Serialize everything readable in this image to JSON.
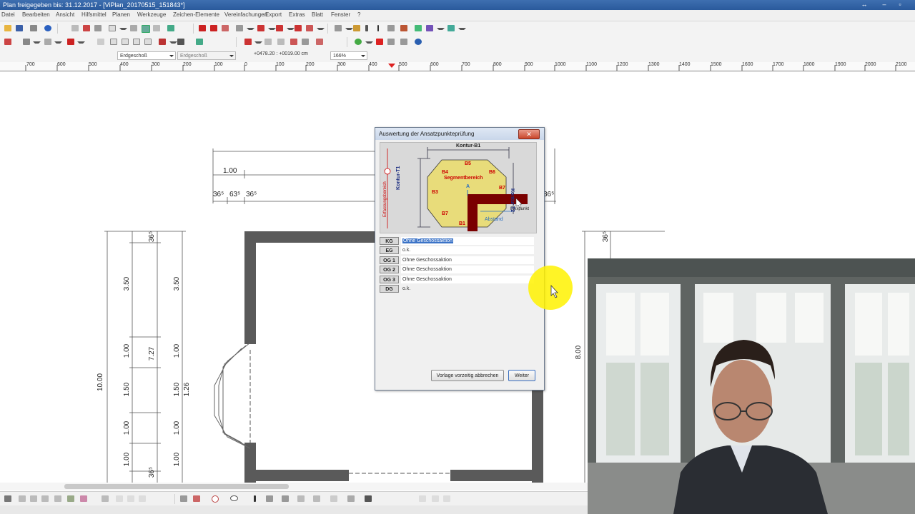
{
  "window": {
    "title": "Plan freigegeben bis: 31.12.2017 - [ViPlan_20170515_151843*]",
    "controls": [
      "↔",
      "–",
      "▫"
    ]
  },
  "menu": [
    "Datei",
    "Bearbeiten",
    "Ansicht",
    "Hilfsmittel",
    "Planen",
    "Werkzeuge",
    "Zeichen-Elemente",
    "Vereinfachungen",
    "Export",
    "Extras",
    "Blatt",
    "Fenster",
    "?"
  ],
  "toolbar2": {
    "floor_combo": "Erdgeschoß",
    "floor_combo2": "Erdgeschoß",
    "coords": "+0478.20 : +0019.00 cm",
    "zoom": "166%"
  },
  "ruler": {
    "labels": [
      "700",
      "600",
      "500",
      "400",
      "300",
      "200",
      "100",
      "0",
      "100",
      "200",
      "300",
      "400",
      "500",
      "600",
      "700",
      "800",
      "900",
      "1000",
      "1100",
      "1200",
      "1300",
      "1400",
      "1500",
      "1600",
      "1700",
      "1800",
      "1900",
      "2000",
      "2100"
    ]
  },
  "drawing": {
    "dim_top": "1.00",
    "dim_row": [
      "36⁵",
      "63⁵",
      "36⁵"
    ],
    "dim_right_small": "36⁵",
    "dim_v_top": "36⁵",
    "dim_v_bottom": "36⁵",
    "dim_v_right": "36⁵",
    "dim_left_total": "10.00",
    "dim_left_col2": [
      "3.50",
      "1.00",
      "1.50",
      "1.00",
      "1.00"
    ],
    "dim_727": "7.27",
    "dim_left_col3": [
      "3.50",
      "1.00",
      "1.50",
      "1.00",
      "1.00"
    ],
    "dim_126": "1.26",
    "dim_right_800": "8.00"
  },
  "dialog": {
    "title": "Auswertung der Ansatzpunkteprüfung",
    "close": "✕",
    "diagram": {
      "kontur_b1": "Kontur-B1",
      "kontur_t1": "Kontur-T1",
      "kontur_t2": "Kontur T2",
      "segment": "Segmentbereich",
      "abstand": "Abstand",
      "flex": "Flexpunkt",
      "side": "Erfassungsbereich",
      "a": "A",
      "points": [
        "B5",
        "B4",
        "B6",
        "B3",
        "B7",
        "B7",
        "B1"
      ]
    },
    "levels": [
      {
        "code": "KG",
        "value": "Ohne Geschossaktion",
        "selected": true
      },
      {
        "code": "EG",
        "value": "o.k.",
        "selected": false
      },
      {
        "code": "OG 1",
        "value": "Ohne Geschossaktion",
        "selected": false
      },
      {
        "code": "OG 2",
        "value": "Ohne Geschossaktion",
        "selected": false
      },
      {
        "code": "OG 3",
        "value": "Ohne Geschossaktion",
        "selected": false
      },
      {
        "code": "DG",
        "value": "o.k.",
        "selected": false
      }
    ],
    "btn_abort": "Vorlage vorzeitig abbrechen",
    "btn_next": "Weiter"
  },
  "colors": {
    "titlebar": "#2a5a9c",
    "wall": "#555555",
    "segment_fill": "#e8dc7a",
    "contour": "#7a0000",
    "highlight": "#fff200"
  }
}
